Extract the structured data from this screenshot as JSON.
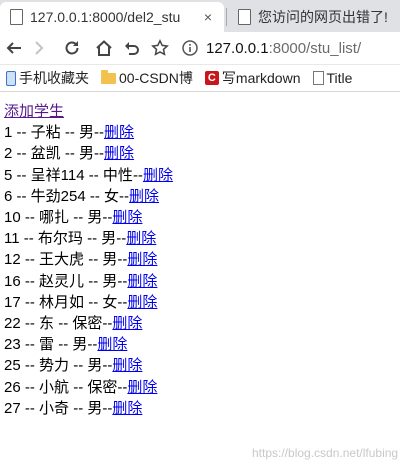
{
  "tabs": [
    {
      "title": "127.0.0.1:8000/del2_stu",
      "active": true,
      "close": "×"
    },
    {
      "title": "您访问的网页出错了!",
      "active": false,
      "close": "×"
    }
  ],
  "address": {
    "host": "127.0.0.1",
    "rest": ":8000/stu_list/"
  },
  "bookmarks": [
    {
      "icon": "mobile-icon",
      "label": "手机收藏夹"
    },
    {
      "icon": "folder-icon",
      "label": "00-CSDN博"
    },
    {
      "icon": "csdn-icon",
      "icon_text": "C",
      "label": "写markdown"
    },
    {
      "icon": "page-icon",
      "label": "Title"
    }
  ],
  "content": {
    "add_link": "添加学生",
    "delete_label": "删除",
    "students": [
      {
        "id": "1",
        "name": "子粘",
        "gender": "男"
      },
      {
        "id": "2",
        "name": "盆凯",
        "gender": "男"
      },
      {
        "id": "5",
        "name": "呈祥114",
        "gender": "中性"
      },
      {
        "id": "6",
        "name": "牛劲254",
        "gender": "女"
      },
      {
        "id": "10",
        "name": "哪扎",
        "gender": "男"
      },
      {
        "id": "11",
        "name": "布尔玛",
        "gender": "男"
      },
      {
        "id": "12",
        "name": "王大虎",
        "gender": "男"
      },
      {
        "id": "16",
        "name": "赵灵儿",
        "gender": "男"
      },
      {
        "id": "17",
        "name": "林月如",
        "gender": "女"
      },
      {
        "id": "22",
        "name": "东",
        "gender": "保密"
      },
      {
        "id": "23",
        "name": "雷",
        "gender": "男"
      },
      {
        "id": "25",
        "name": "势力",
        "gender": "男"
      },
      {
        "id": "26",
        "name": "小航",
        "gender": "保密"
      },
      {
        "id": "27",
        "name": "小奇",
        "gender": "男"
      }
    ]
  },
  "watermark": "https://blog.csdn.net/lfubing"
}
